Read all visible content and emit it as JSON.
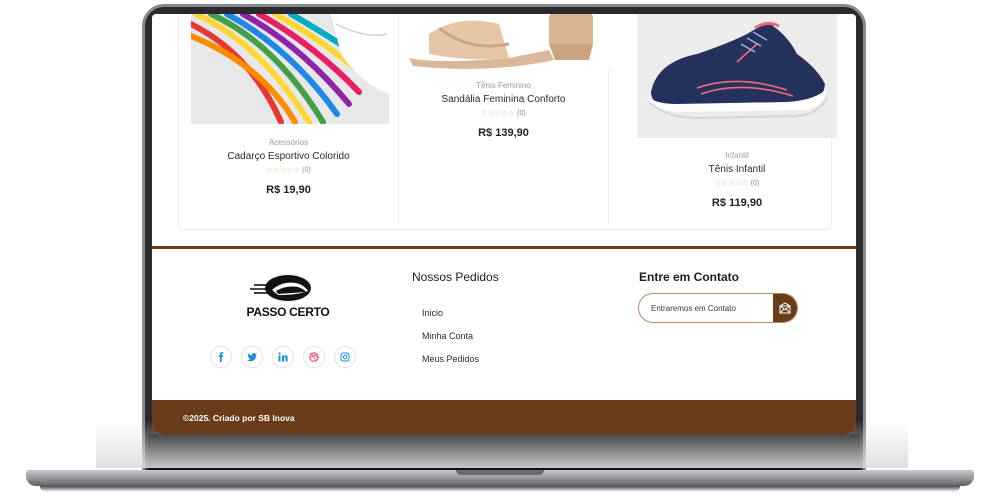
{
  "products": [
    {
      "category": "Acessórios",
      "name": "Cadarço Esportivo Colorido",
      "stars": "☆☆☆☆☆",
      "reviews": "(0)",
      "price": "R$ 19,90",
      "image": "rainbow-shoelaces-image"
    },
    {
      "category": "Tênis Feminino",
      "name": "Sandália Feminina Conforto",
      "stars": "☆☆☆☆☆",
      "reviews": "(0)",
      "price": "R$ 139,90",
      "image": "beige-sandal-image"
    },
    {
      "category": "Infantil",
      "name": "Tênis Infantil",
      "stars": "☆☆☆☆☆",
      "reviews": "(0)",
      "price": "R$ 119,90",
      "image": "navy-pink-sneaker-image"
    }
  ],
  "footer": {
    "logo_text": "PASSO CERTO",
    "socials": [
      "facebook-icon",
      "twitter-icon",
      "linkedin-icon",
      "dribbble-icon",
      "instagram-icon"
    ],
    "orders_title": "Nossos Pedidos",
    "links": [
      "Inicio",
      "Minha Conta",
      "Meus Pedidos"
    ],
    "contact_title": "Entre em Contato",
    "contact_placeholder": "Entraremos em Contato",
    "copyright": "©2025. Criado por SB Inova"
  },
  "colors": {
    "brand_brown": "#6b3c19",
    "social_blue": "#1d8fd6",
    "social_pink": "#e0457b",
    "star_color": "#e0b070"
  }
}
